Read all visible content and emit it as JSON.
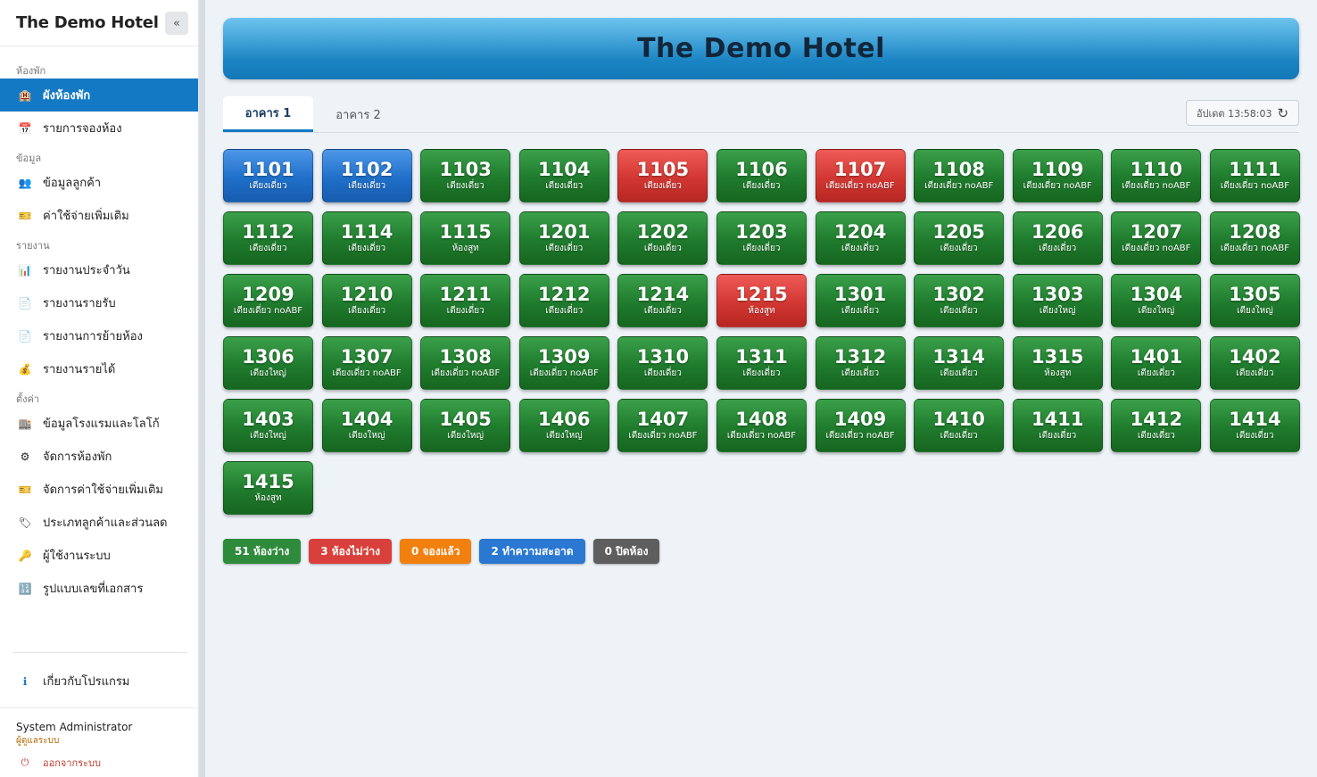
{
  "app": {
    "title": "The Demo Hotel"
  },
  "sidebar": {
    "collapse_label": "«",
    "sections": [
      {
        "label": "ห้องพัก",
        "items": [
          {
            "label": "ผังห้องพัก",
            "icon": "🏨",
            "icon_name": "hotel-icon",
            "active": true
          },
          {
            "label": "รายการจองห้อง",
            "icon": "📅",
            "icon_name": "calendar-icon"
          }
        ]
      },
      {
        "label": "ข้อมูล",
        "items": [
          {
            "label": "ข้อมูลลูกค้า",
            "icon": "👥",
            "icon_name": "users-icon"
          },
          {
            "label": "ค่าใช้จ่ายเพิ่มเติม",
            "icon": "🎫",
            "icon_name": "ticket-icon"
          }
        ]
      },
      {
        "label": "รายงาน",
        "items": [
          {
            "label": "รายงานประจำวัน",
            "icon": "📊",
            "icon_name": "bar-chart-icon"
          },
          {
            "label": "รายงานรายรับ",
            "icon": "📄",
            "icon_name": "document-icon"
          },
          {
            "label": "รายงานการย้ายห้อง",
            "icon": "📄",
            "icon_name": "document-icon"
          },
          {
            "label": "รายงานรายได้",
            "icon": "💰",
            "icon_name": "money-bag-icon"
          }
        ]
      },
      {
        "label": "ตั้งค่า",
        "items": [
          {
            "label": "ข้อมูลโรงแรมและโลโก้",
            "icon": "🏬",
            "icon_name": "building-icon"
          },
          {
            "label": "จัดการห้องพัก",
            "icon": "⚙",
            "icon_name": "gear-icon"
          },
          {
            "label": "จัดการค่าใช้จ่ายเพิ่มเติม",
            "icon": "🎫",
            "icon_name": "ticket-icon"
          },
          {
            "label": "ประเภทลูกค้าและส่วนลด",
            "icon": "🏷",
            "icon_name": "tag-icon"
          },
          {
            "label": "ผู้ใช้งานระบบ",
            "icon": "🔑",
            "icon_name": "key-icon"
          },
          {
            "label": "รูปแบบเลขที่เอกสาร",
            "icon": "🔢",
            "icon_name": "numbers-icon"
          }
        ]
      }
    ],
    "about": {
      "label": "เกี่ยวกับโปรแกรม",
      "icon": "ℹ",
      "icon_name": "info-icon"
    },
    "user": {
      "name": "System Administrator",
      "role": "ผู้ดูแลระบบ",
      "logout_label": "ออกจากระบบ",
      "logout_icon": "⏻"
    }
  },
  "header": {
    "title": "The Demo Hotel"
  },
  "tabs": [
    {
      "label": "อาคาร 1",
      "active": true
    },
    {
      "label": "อาคาร 2",
      "active": false
    }
  ],
  "update": {
    "label": "อัปเดต 13:58:03",
    "icon": "↻"
  },
  "colors": {
    "available": "#1f7b2d",
    "occupied": "#d23732",
    "booked": "#f57c00",
    "cleaning": "#1f6fc9",
    "closed": "#555555",
    "accent": "#1479c4"
  },
  "rooms": [
    {
      "no": "1101",
      "type": "เตียงเดี่ยว",
      "status": "cleaning"
    },
    {
      "no": "1102",
      "type": "เตียงเดี่ยว",
      "status": "cleaning"
    },
    {
      "no": "1103",
      "type": "เตียงเดี่ยว",
      "status": "available"
    },
    {
      "no": "1104",
      "type": "เตียงเดี่ยว",
      "status": "available"
    },
    {
      "no": "1105",
      "type": "เตียงเดี่ยว",
      "status": "occupied"
    },
    {
      "no": "1106",
      "type": "เตียงเดี่ยว",
      "status": "available"
    },
    {
      "no": "1107",
      "type": "เตียงเดี่ยว noABF",
      "status": "occupied"
    },
    {
      "no": "1108",
      "type": "เตียงเดี่ยว noABF",
      "status": "available"
    },
    {
      "no": "1109",
      "type": "เตียงเดี่ยว noABF",
      "status": "available"
    },
    {
      "no": "1110",
      "type": "เตียงเดี่ยว noABF",
      "status": "available"
    },
    {
      "no": "1111",
      "type": "เตียงเดี่ยว noABF",
      "status": "available"
    },
    {
      "no": "1112",
      "type": "เตียงเดี่ยว",
      "status": "available"
    },
    {
      "no": "1114",
      "type": "เตียงเดี่ยว",
      "status": "available"
    },
    {
      "no": "1115",
      "type": "ห้องสูท",
      "status": "available"
    },
    {
      "no": "1201",
      "type": "เตียงเดี่ยว",
      "status": "available"
    },
    {
      "no": "1202",
      "type": "เตียงเดี่ยว",
      "status": "available"
    },
    {
      "no": "1203",
      "type": "เตียงเดี่ยว",
      "status": "available"
    },
    {
      "no": "1204",
      "type": "เตียงเดี่ยว",
      "status": "available"
    },
    {
      "no": "1205",
      "type": "เตียงเดี่ยว",
      "status": "available"
    },
    {
      "no": "1206",
      "type": "เตียงเดี่ยว",
      "status": "available"
    },
    {
      "no": "1207",
      "type": "เตียงเดี่ยว noABF",
      "status": "available"
    },
    {
      "no": "1208",
      "type": "เตียงเดี่ยว noABF",
      "status": "available"
    },
    {
      "no": "1209",
      "type": "เตียงเดี่ยว noABF",
      "status": "available"
    },
    {
      "no": "1210",
      "type": "เตียงเดี่ยว",
      "status": "available"
    },
    {
      "no": "1211",
      "type": "เตียงเดี่ยว",
      "status": "available"
    },
    {
      "no": "1212",
      "type": "เตียงเดี่ยว",
      "status": "available"
    },
    {
      "no": "1214",
      "type": "เตียงเดี่ยว",
      "status": "available"
    },
    {
      "no": "1215",
      "type": "ห้องสูท",
      "status": "occupied"
    },
    {
      "no": "1301",
      "type": "เตียงเดี่ยว",
      "status": "available"
    },
    {
      "no": "1302",
      "type": "เตียงเดี่ยว",
      "status": "available"
    },
    {
      "no": "1303",
      "type": "เตียงใหญ่",
      "status": "available"
    },
    {
      "no": "1304",
      "type": "เตียงใหญ่",
      "status": "available"
    },
    {
      "no": "1305",
      "type": "เตียงใหญ่",
      "status": "available"
    },
    {
      "no": "1306",
      "type": "เตียงใหญ่",
      "status": "available"
    },
    {
      "no": "1307",
      "type": "เตียงเดี่ยว noABF",
      "status": "available"
    },
    {
      "no": "1308",
      "type": "เตียงเดี่ยว noABF",
      "status": "available"
    },
    {
      "no": "1309",
      "type": "เตียงเดี่ยว noABF",
      "status": "available"
    },
    {
      "no": "1310",
      "type": "เตียงเดี่ยว",
      "status": "available"
    },
    {
      "no": "1311",
      "type": "เตียงเดี่ยว",
      "status": "available"
    },
    {
      "no": "1312",
      "type": "เตียงเดี่ยว",
      "status": "available"
    },
    {
      "no": "1314",
      "type": "เตียงเดี่ยว",
      "status": "available"
    },
    {
      "no": "1315",
      "type": "ห้องสูท",
      "status": "available"
    },
    {
      "no": "1401",
      "type": "เตียงเดี่ยว",
      "status": "available"
    },
    {
      "no": "1402",
      "type": "เตียงเดี่ยว",
      "status": "available"
    },
    {
      "no": "1403",
      "type": "เตียงใหญ่",
      "status": "available"
    },
    {
      "no": "1404",
      "type": "เตียงใหญ่",
      "status": "available"
    },
    {
      "no": "1405",
      "type": "เตียงใหญ่",
      "status": "available"
    },
    {
      "no": "1406",
      "type": "เตียงใหญ่",
      "status": "available"
    },
    {
      "no": "1407",
      "type": "เตียงเดี่ยว noABF",
      "status": "available"
    },
    {
      "no": "1408",
      "type": "เตียงเดี่ยว noABF",
      "status": "available"
    },
    {
      "no": "1409",
      "type": "เตียงเดี่ยว noABF",
      "status": "available"
    },
    {
      "no": "1410",
      "type": "เตียงเดี่ยว",
      "status": "available"
    },
    {
      "no": "1411",
      "type": "เตียงเดี่ยว",
      "status": "available"
    },
    {
      "no": "1412",
      "type": "เตียงเดี่ยว",
      "status": "available"
    },
    {
      "no": "1414",
      "type": "เตียงเดี่ยว",
      "status": "available"
    },
    {
      "no": "1415",
      "type": "ห้องสูท",
      "status": "available"
    }
  ],
  "legend": [
    {
      "label": "51 ห้องว่าง",
      "status": "available",
      "color": "#2e8b3c"
    },
    {
      "label": "3 ห้องไม่ว่าง",
      "status": "occupied",
      "color": "#d9403b"
    },
    {
      "label": "0 จองแล้ว",
      "status": "booked",
      "color": "#f2800f"
    },
    {
      "label": "2 ทำความสะอาด",
      "status": "cleaning",
      "color": "#2a78d2"
    },
    {
      "label": "0 ปิดห้อง",
      "status": "closed",
      "color": "#5e5e5e"
    }
  ]
}
